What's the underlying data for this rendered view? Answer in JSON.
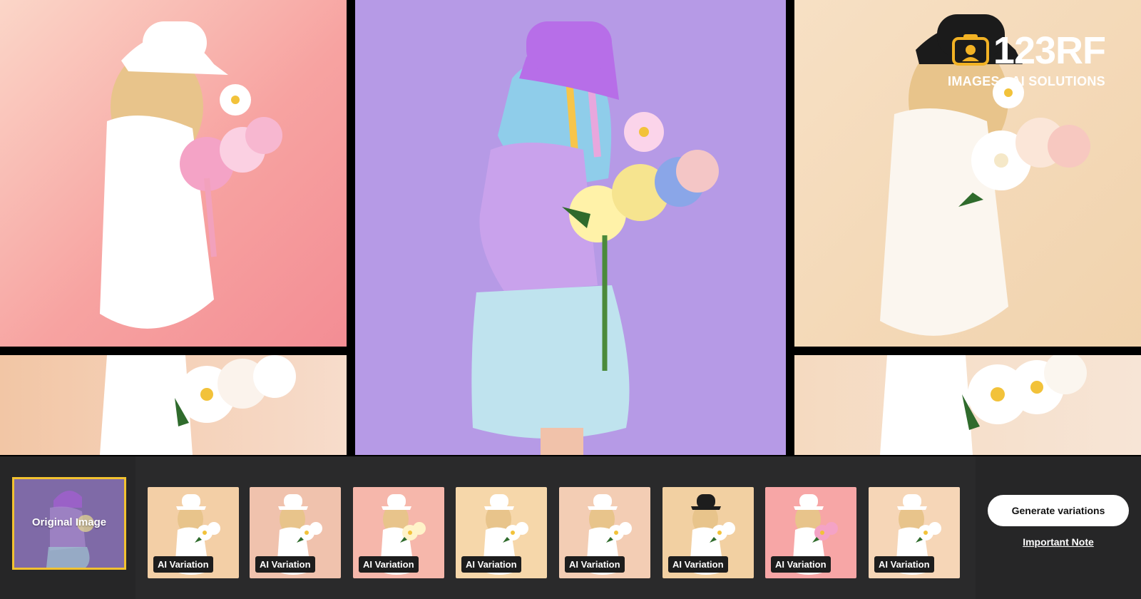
{
  "brand": {
    "name": "123RF",
    "tagline": "IMAGES • AI SOLUTIONS",
    "logo_icon": "camera-icon"
  },
  "original": {
    "label": "Original Image"
  },
  "variations": [
    {
      "label": "AI Variation",
      "bg": "#f3cfa6",
      "hat": "#ffffff",
      "flower": "#ffffff"
    },
    {
      "label": "AI Variation",
      "bg": "#f0c2ad",
      "hat": "#ffffff",
      "flower": "#ffffff"
    },
    {
      "label": "AI Variation",
      "bg": "#f6b7ab",
      "hat": "#ffffff",
      "flower": "#fff3c9"
    },
    {
      "label": "AI Variation",
      "bg": "#f6d7aa",
      "hat": "#ffffff",
      "flower": "#ffffff"
    },
    {
      "label": "AI Variation",
      "bg": "#f3cdb4",
      "hat": "#ffffff",
      "flower": "#ffffff"
    },
    {
      "label": "AI Variation",
      "bg": "#f2d0a2",
      "hat": "#1d1d1d",
      "flower": "#ffffff"
    },
    {
      "label": "AI Variation",
      "bg": "#f7a6a6",
      "hat": "#ffffff",
      "flower": "#f4a3c6"
    },
    {
      "label": "AI Variation",
      "bg": "#f6d6b7",
      "hat": "#ffffff",
      "flower": "#ffffff"
    }
  ],
  "actions": {
    "generate_label": "Generate variations",
    "note_label": "Important Note"
  },
  "colors": {
    "selected_border": "#f2c230",
    "toolbar_bg": "#2a2a2b",
    "center_bg": "#b69ae6"
  }
}
